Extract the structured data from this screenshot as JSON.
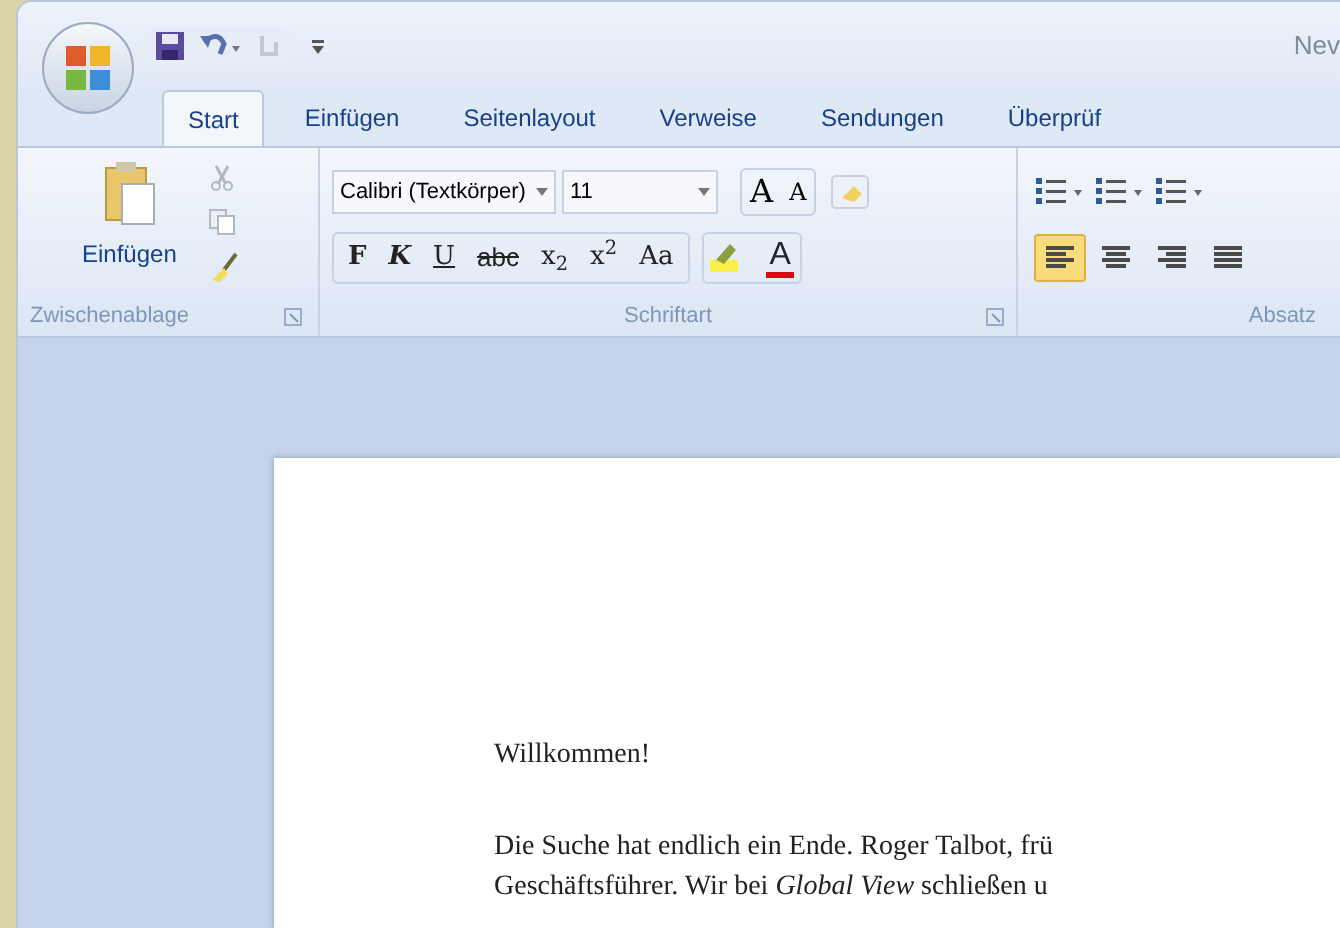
{
  "window": {
    "title": "Nev"
  },
  "tabs": [
    {
      "label": "Start",
      "selected": true
    },
    {
      "label": "Einfügen",
      "selected": false
    },
    {
      "label": "Seitenlayout",
      "selected": false
    },
    {
      "label": "Verweise",
      "selected": false
    },
    {
      "label": "Sendungen",
      "selected": false
    },
    {
      "label": "Überprüf",
      "selected": false
    }
  ],
  "clipboard": {
    "paste_label": "Einfügen",
    "group_label": "Zwischenablage"
  },
  "font": {
    "family": "Calibri (Textkörper)",
    "size": "11",
    "grow": "A",
    "shrink": "A",
    "group_label": "Schriftart",
    "format_buttons": [
      {
        "label": "F",
        "kind": "bold"
      },
      {
        "label": "K",
        "kind": "italic"
      },
      {
        "label": "U",
        "kind": "underline"
      },
      {
        "label": "abc",
        "kind": "strike"
      },
      {
        "label": "x$_{2}$",
        "kind": "plain"
      },
      {
        "label": "x$^{2}$",
        "kind": "plain"
      },
      {
        "label": "Aa",
        "kind": "plain"
      }
    ],
    "font_color_label": "A"
  },
  "paragraph": {
    "group_label": "Absatz",
    "alignments": [
      {
        "selected": true
      },
      {
        "selected": false
      },
      {
        "selected": false
      },
      {
        "selected": false
      }
    ]
  },
  "document": {
    "heading": "Willkommen!",
    "lines": [
      "Die Suche hat endlich ein Ende. Roger Talbot, frü",
      "Geschäftsführer. Wir bei *Global View* schließen u"
    ]
  }
}
